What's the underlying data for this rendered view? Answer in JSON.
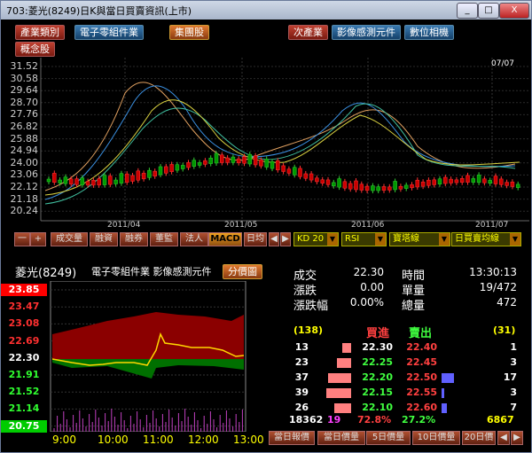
{
  "window": {
    "title": "703:菱光(8249)日K與當日買賣資訊(上市)",
    "min": "_",
    "max": "□",
    "close": "X"
  },
  "buttons": [
    "產業類別",
    "電子零組件業",
    "集團股",
    "次產業",
    "影像感測元件",
    "數位相機",
    "概念股"
  ],
  "chart": {
    "date_top": "07/07",
    "price_labels": [
      "31.52",
      "30.58",
      "29.64",
      "28.70",
      "27.76",
      "26.82",
      "25.88",
      "24.94",
      "24.00",
      "23.06",
      "22.12",
      "21.18",
      "20.24"
    ],
    "month_labels": [
      "2011/04",
      "2011/05",
      "2011/06",
      "2011/07"
    ]
  },
  "toolbar": {
    "tabs": [
      "一",
      "+",
      "成交量",
      "融資",
      "融券",
      "董監",
      "法人",
      "MACD",
      "日均"
    ],
    "selects": [
      "KD 20",
      "RSI",
      "寶塔線",
      "日買賣均線"
    ]
  },
  "stock": {
    "name": "菱光(8249)",
    "industry": "電子零組件業 影像感測元件",
    "tab": "分價圖"
  },
  "intraday": {
    "price_ticks": [
      {
        "v": "23.85",
        "c": "#ff0000",
        "bg": "#ff0000"
      },
      {
        "v": "23.47",
        "c": "#ff3030",
        "bg": ""
      },
      {
        "v": "23.08",
        "c": "#ff3030",
        "bg": ""
      },
      {
        "v": "22.69",
        "c": "#ff3030",
        "bg": ""
      },
      {
        "v": "22.30",
        "c": "#ffffff",
        "bg": ""
      },
      {
        "v": "21.91",
        "c": "#30ff30",
        "bg": ""
      },
      {
        "v": "21.52",
        "c": "#30ff30",
        "bg": ""
      },
      {
        "v": "21.14",
        "c": "#30ff30",
        "bg": ""
      },
      {
        "v": "20.75",
        "c": "#00ff00",
        "bg": "#00cc00"
      }
    ],
    "time_ticks": [
      "9:00",
      "10:00",
      "11:00",
      "12:00",
      "13:00"
    ]
  },
  "quote": {
    "labels": [
      "成交",
      "漲跌",
      "漲跌幅"
    ],
    "values": [
      "22.30",
      "0.00",
      "0.00%"
    ],
    "r_labels": [
      "時間",
      "單量",
      "總量"
    ],
    "r_values": [
      "13:30:13",
      "19/472",
      "472"
    ]
  },
  "book": {
    "bid_count": "(138)",
    "bid_title": "買進",
    "ask_title": "賣出",
    "ask_count": "(31)",
    "rows": [
      {
        "bv": "13",
        "bp": "22.30",
        "ap": "22.40",
        "av": "1",
        "bw": 10,
        "aw": 0
      },
      {
        "bv": "23",
        "bp": "22.25",
        "ap": "22.45",
        "av": "3",
        "bw": 16,
        "aw": 0
      },
      {
        "bv": "37",
        "bp": "22.20",
        "ap": "22.50",
        "av": "17",
        "bw": 26,
        "aw": 14
      },
      {
        "bv": "39",
        "bp": "22.15",
        "ap": "22.55",
        "av": "3",
        "bw": 28,
        "aw": 3
      },
      {
        "bv": "26",
        "bp": "22.10",
        "ap": "22.60",
        "av": "7",
        "bw": 19,
        "aw": 6
      }
    ],
    "totals": [
      "18362",
      "19",
      "72.8%",
      "27.2%",
      "6867"
    ]
  },
  "bottom_tabs": [
    "當日報價",
    "當日價量",
    "5日價量",
    "10日價量",
    "20日價"
  ]
}
